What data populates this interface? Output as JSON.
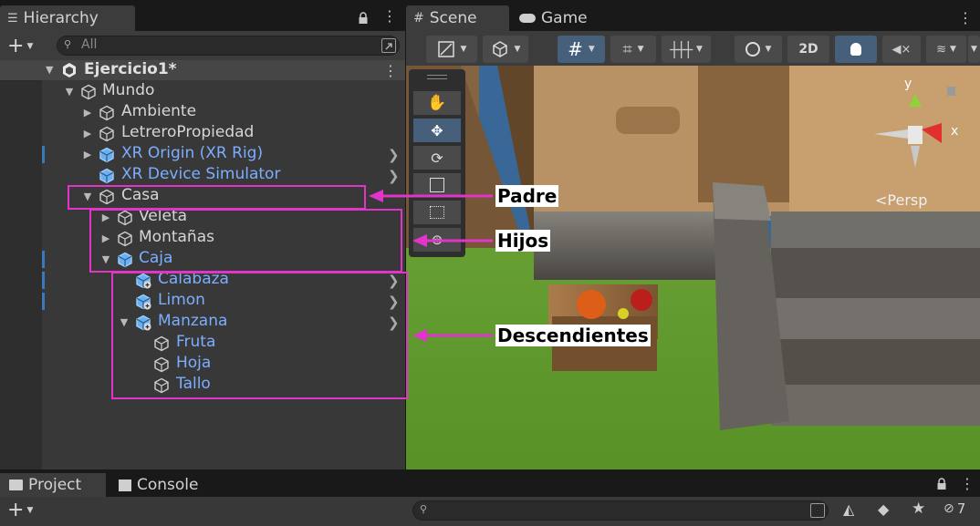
{
  "hierarchy": {
    "tab_label": "Hierarchy",
    "add_label": "+",
    "search_placeholder": "All",
    "scene_name": "Ejercicio1*",
    "rows": [
      {
        "label": "Mundo",
        "color": "gray",
        "arrow": "down"
      },
      {
        "label": "Ambiente",
        "color": "gray",
        "arrow": "right"
      },
      {
        "label": "LetreroPropiedad",
        "color": "gray",
        "arrow": "right"
      },
      {
        "label": "XR Origin (XR Rig)",
        "color": "blue",
        "arrow": "right"
      },
      {
        "label": "XR Device Simulator",
        "color": "blue",
        "arrow": "none"
      },
      {
        "label": "Casa",
        "color": "gray",
        "arrow": "down"
      },
      {
        "label": "Veleta",
        "color": "gray",
        "arrow": "right"
      },
      {
        "label": "Montañas",
        "color": "gray",
        "arrow": "right"
      },
      {
        "label": "Caja",
        "color": "blue",
        "arrow": "down"
      },
      {
        "label": "Calabaza",
        "color": "blue",
        "arrow": "none"
      },
      {
        "label": "Limon",
        "color": "blue",
        "arrow": "none"
      },
      {
        "label": "Manzana",
        "color": "blue",
        "arrow": "down"
      },
      {
        "label": "Fruta",
        "color": "blue",
        "arrow": "none"
      },
      {
        "label": "Hoja",
        "color": "blue",
        "arrow": "none"
      },
      {
        "label": "Tallo",
        "color": "blue",
        "arrow": "none"
      }
    ]
  },
  "scene": {
    "tab_scene": "Scene",
    "tab_game": "Game",
    "btn_2d": "2D",
    "persp_label": "Persp",
    "axis_y": "y",
    "axis_x": "x"
  },
  "bottom": {
    "tab_project": "Project",
    "tab_console": "Console",
    "add_label": "+",
    "hidden_count": "7"
  },
  "annotations": {
    "padre": "Padre",
    "hijos": "Hijos",
    "descendientes": "Descendientes"
  },
  "colors": {
    "annotation": "#e035c8",
    "link_blue": "#7caeff"
  }
}
